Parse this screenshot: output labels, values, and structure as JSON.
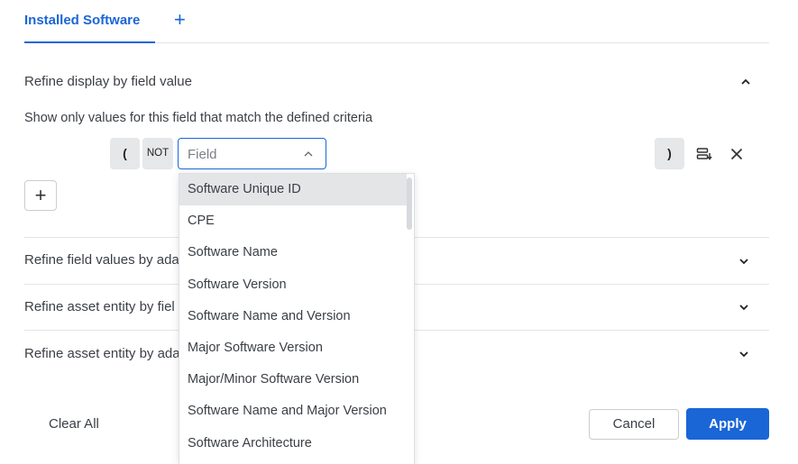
{
  "tabs": {
    "active_label": "Installed Software",
    "add_symbol": "+"
  },
  "sections": {
    "refine_display": "Refine display by field value",
    "refine_field_values": "Refine field values by ada",
    "refine_asset_field": "Refine asset entity by fiel",
    "refine_asset_adapter": "Refine asset entity by ada"
  },
  "criteria": {
    "description": "Show only values for this field that match the defined criteria",
    "open_paren": "(",
    "not_label": "NOT",
    "field_placeholder": "Field",
    "close_paren": ")",
    "add_symbol": "+"
  },
  "dropdown": {
    "options": [
      "Software Unique ID",
      "CPE",
      "Software Name",
      "Software Version",
      "Software Name and Version",
      "Major Software Version",
      "Major/Minor Software Version",
      "Software Name and Major Version",
      "Software Architecture"
    ],
    "highlighted_index": 0
  },
  "footer": {
    "clear_all": "Clear All",
    "cancel": "Cancel",
    "apply": "Apply"
  },
  "colors": {
    "accent": "#1a66d6",
    "hover_bg": "#e4e5e7"
  }
}
